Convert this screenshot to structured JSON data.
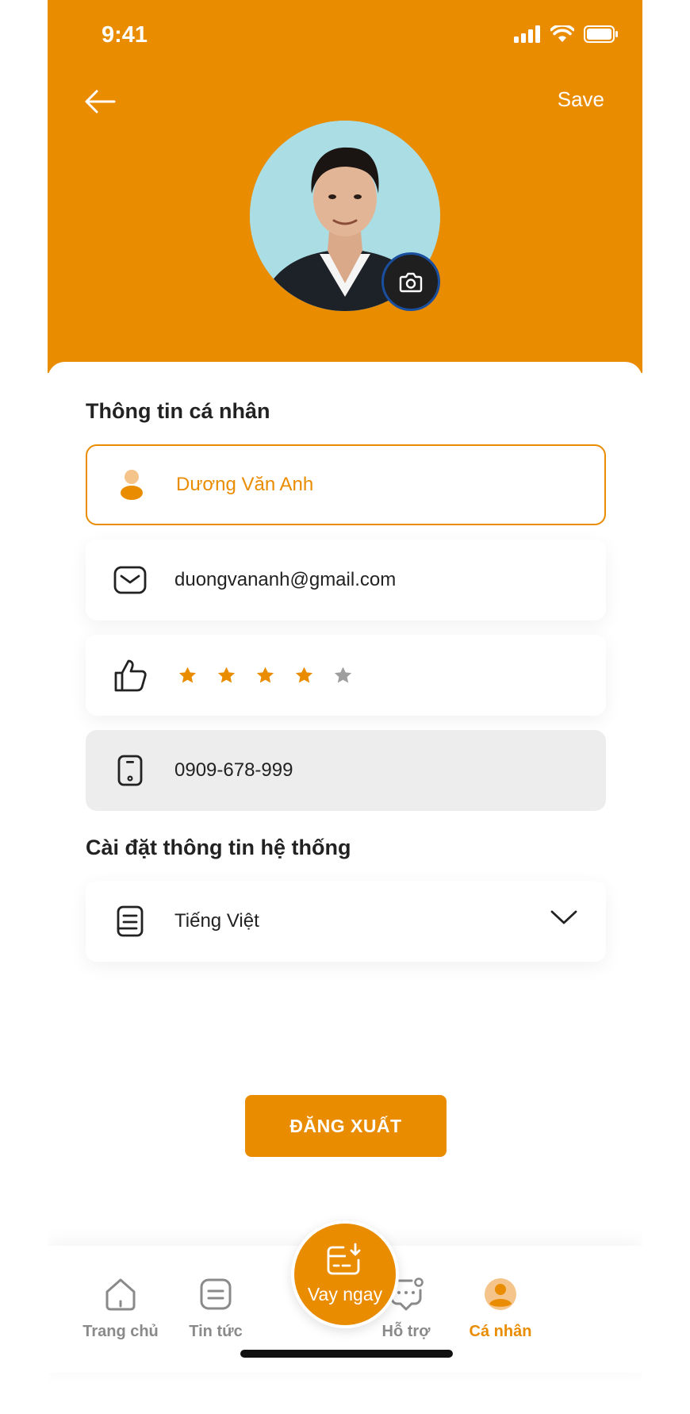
{
  "status": {
    "time": "9:41"
  },
  "header": {
    "save_label": "Save"
  },
  "personal": {
    "title": "Thông tin cá nhân",
    "name": "Dương Văn Anh",
    "email": "duongvananh@gmail.com",
    "rating": {
      "value": 4,
      "max": 5
    },
    "phone": "0909-678-999"
  },
  "system": {
    "title": "Cài đặt thông tin hệ thống",
    "language": "Tiếng Việt"
  },
  "logout_label": "ĐĂNG XUẤT",
  "tabbar": {
    "home": "Trang chủ",
    "news": "Tin tức",
    "loan": "Vay ngay",
    "support": "Hỗ trợ",
    "profile": "Cá nhân"
  },
  "colors": {
    "accent": "#EA8C00",
    "star_off": "#9E9E9E",
    "field_disabled": "#EDEDED"
  }
}
